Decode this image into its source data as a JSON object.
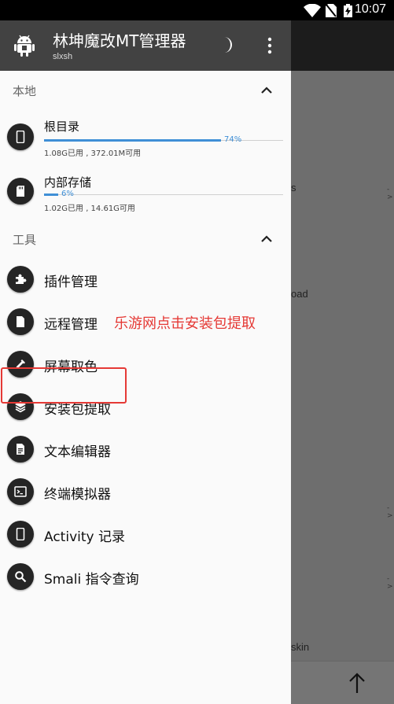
{
  "status_bar": {
    "time": "10:07"
  },
  "header": {
    "title": "林坤魔改MT管理器",
    "subtitle": "slxsh"
  },
  "sections": {
    "local": {
      "title": "本地"
    },
    "tools": {
      "title": "工具"
    }
  },
  "storage": [
    {
      "label": "根目录",
      "percent_label": "74%",
      "percent": 74,
      "detail": "1.08G已用 , 372.01M可用"
    },
    {
      "label": "内部存储",
      "percent_label": "6%",
      "percent": 6,
      "detail": "1.02G已用 , 14.61G可用"
    }
  ],
  "tools": [
    {
      "label": "插件管理",
      "icon": "puzzle-icon"
    },
    {
      "label": "远程管理",
      "icon": "file-icon"
    },
    {
      "label": "屏幕取色",
      "icon": "eyedropper-icon"
    },
    {
      "label": "安装包提取",
      "icon": "layers-icon"
    },
    {
      "label": "文本编辑器",
      "icon": "document-icon"
    },
    {
      "label": "终端模拟器",
      "icon": "terminal-icon"
    },
    {
      "label": "Activity 记录",
      "icon": "phone-icon"
    },
    {
      "label": "Smali 指令查询",
      "icon": "search-icon"
    }
  ],
  "annotation": "乐游网点击安装包提取",
  "background_app": {
    "fragments": [
      "s",
      "oad",
      "skin"
    ],
    "arrows": [
      "->",
      "->",
      "->"
    ]
  },
  "colors": {
    "header": "#424242",
    "accent": "#3f8fd6",
    "annotation": "#e53935",
    "icon_bg": "#252525"
  }
}
